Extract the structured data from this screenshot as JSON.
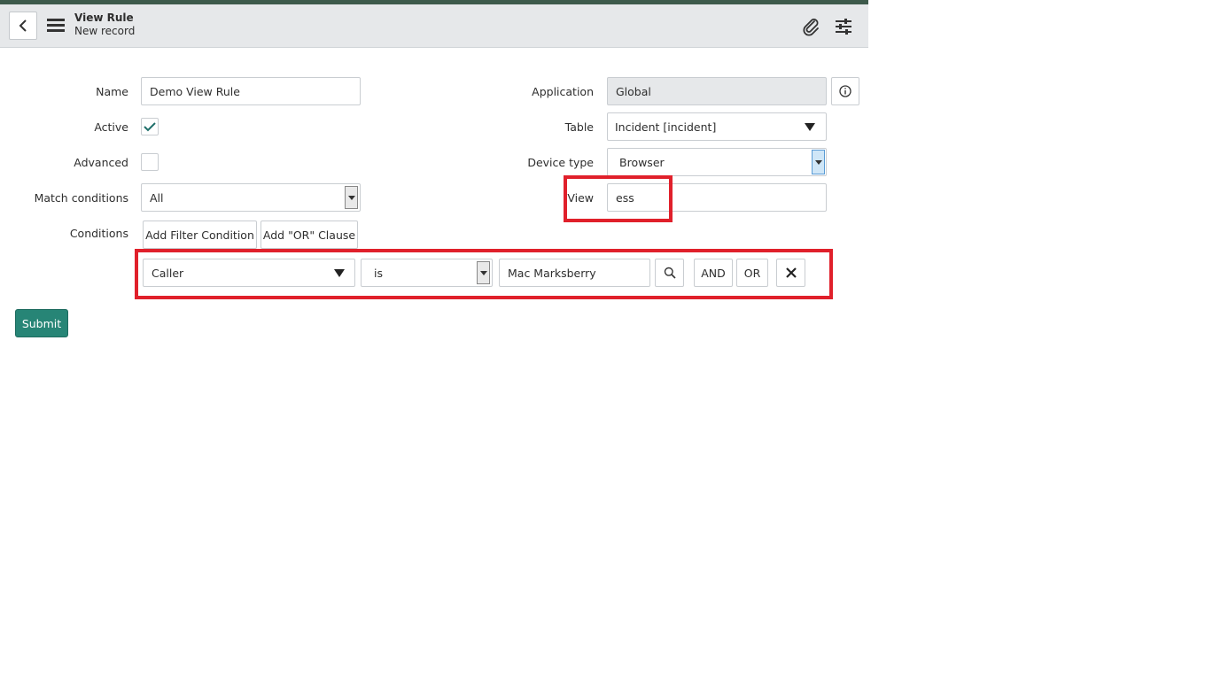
{
  "header": {
    "title": "View Rule",
    "subtitle": "New record"
  },
  "form": {
    "name_label": "Name",
    "name_value": "Demo View Rule",
    "active_label": "Active",
    "active_checked": true,
    "advanced_label": "Advanced",
    "advanced_checked": false,
    "match_label": "Match conditions",
    "match_value": "All",
    "conditions_label": "Conditions",
    "add_filter_label": "Add Filter Condition",
    "add_or_label": "Add \"OR\" Clause",
    "application_label": "Application",
    "application_value": "Global",
    "table_label": "Table",
    "table_value": "Incident [incident]",
    "device_label": "Device type",
    "device_value": "Browser",
    "view_label": "View",
    "view_value": "ess"
  },
  "condition_row": {
    "field": "Caller",
    "operator": "is",
    "value": "Mac Marksberry",
    "and_label": "AND",
    "or_label": "OR"
  },
  "submit_label": "Submit",
  "colors": {
    "highlight": "#e0202b",
    "primary": "#278576",
    "header_bg": "#e6e8ea"
  },
  "icons": [
    "back-icon",
    "menu-icon",
    "paperclip-icon",
    "settings-sliders-icon",
    "info-icon",
    "search-icon",
    "close-icon",
    "checkmark-icon"
  ]
}
